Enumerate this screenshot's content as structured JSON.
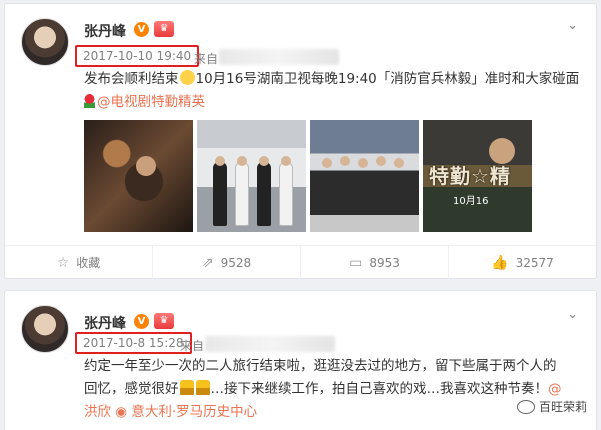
{
  "posts": [
    {
      "author": "张丹峰",
      "verified_badge": "V",
      "crown_badge": "♛",
      "time": "2017-10-10 19:40",
      "from_prefix": "来自",
      "menu_icon": "chevron-down-icon",
      "text_a": "发布会顺利结束",
      "text_b": "10月16号湖南卫视每晚19:40「消防官兵林毅」准时和大家碰面",
      "mention": "@电视剧特勤精英",
      "photo_text": {
        "title": "特勤☆精",
        "date": "10月16"
      },
      "actions": [
        {
          "icon": "☆",
          "label": "收藏"
        },
        {
          "icon": "⇗",
          "label": "9528"
        },
        {
          "icon": "▭",
          "label": "8953"
        },
        {
          "icon": "👍",
          "label": "32577"
        }
      ]
    },
    {
      "author": "张丹峰",
      "verified_badge": "V",
      "crown_badge": "♛",
      "time": "2017-10-8 15:28",
      "from_prefix": "来自",
      "menu_icon": "chevron-down-icon",
      "text_line1": "约定一年至少一次的二人旅行结束啦，逛逛没去过的地方，留下些属于两个人的",
      "text_line2_a": "回忆，感觉很好",
      "text_line2_b": "…接下来继续工作，拍自己喜欢的戏…我喜欢这种节奏！",
      "mention_a": "@",
      "mention_b": "洪欣",
      "location_icon": "◉",
      "location": "意大利·罗马历史中心"
    }
  ],
  "watermark": "百旺荣莉",
  "colors": {
    "accent": "#eb7350",
    "highlight": "#e02020",
    "badge": "#ff8200"
  }
}
